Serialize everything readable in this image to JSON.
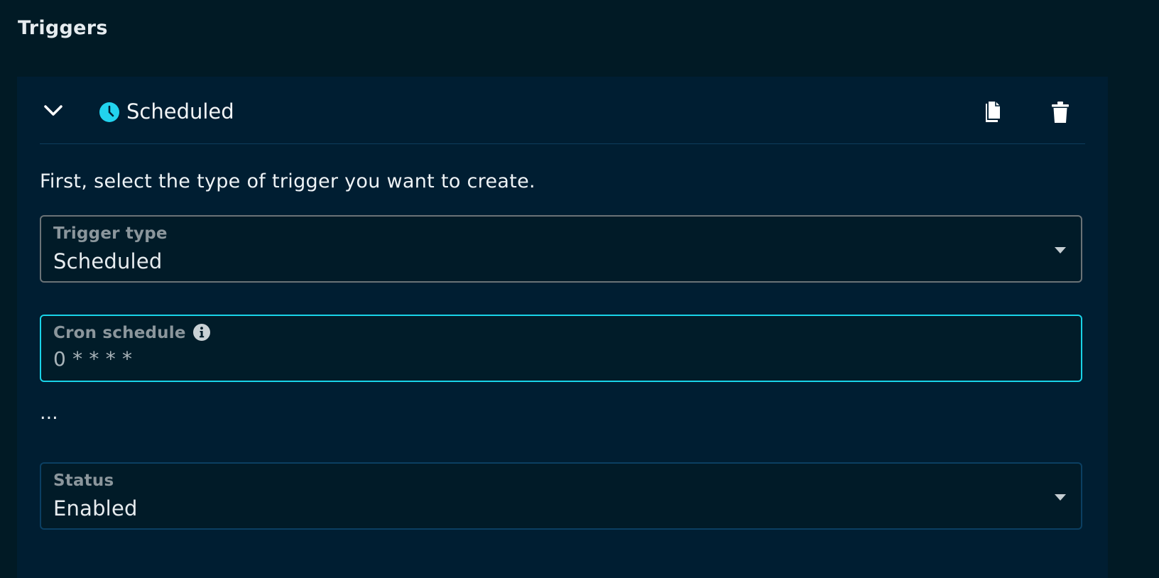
{
  "section": {
    "title": "Triggers"
  },
  "trigger": {
    "header_title": "Scheduled",
    "intro": "First, select the type of trigger you want to create.",
    "trigger_type": {
      "label": "Trigger type",
      "value": "Scheduled"
    },
    "cron": {
      "label": "Cron schedule",
      "value": "0 * * * *"
    },
    "ellipsis": "...",
    "status": {
      "label": "Status",
      "value": "Enabled"
    }
  },
  "icons": {
    "chevron": "chevron-down-icon",
    "clock": "clock-icon",
    "copy": "copy-icon",
    "delete": "trash-icon",
    "info": "info-icon",
    "caret": "caret-down-icon"
  },
  "colors": {
    "background": "#011a25",
    "card": "#001e32",
    "accent": "#19d3e8",
    "divider": "#0d3d5c"
  }
}
